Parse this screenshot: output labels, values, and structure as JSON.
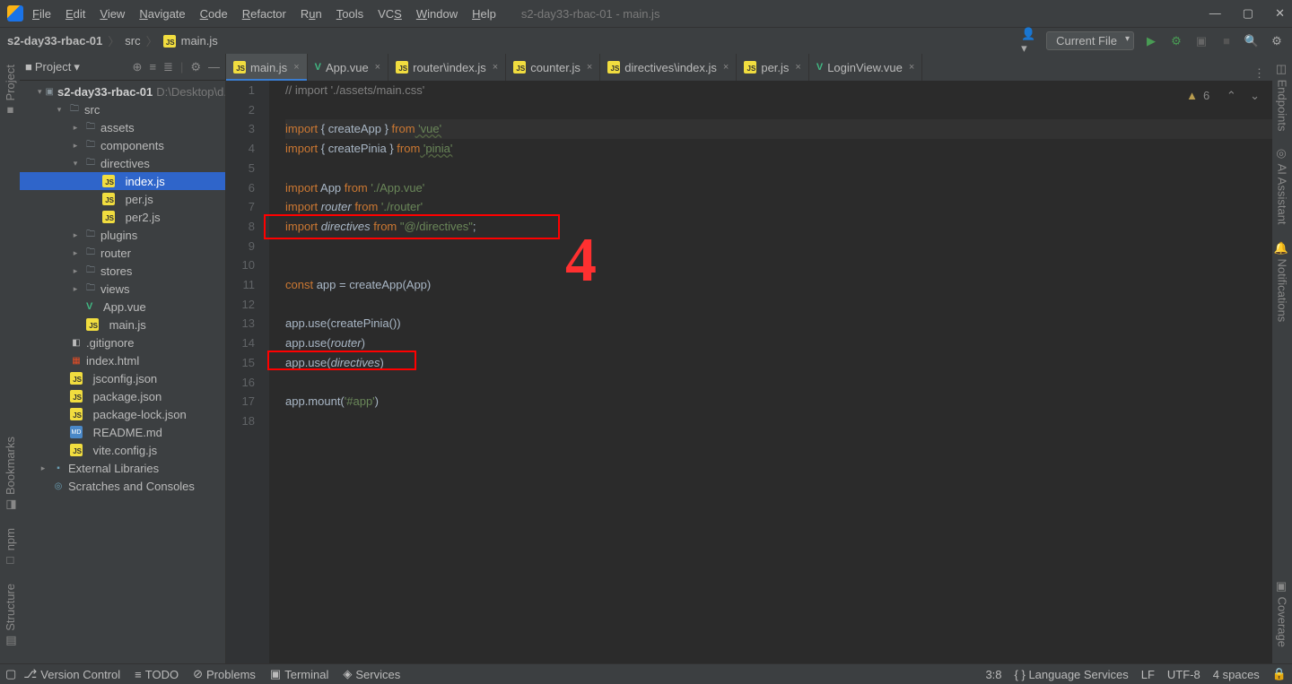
{
  "window": {
    "title": "s2-day33-rbac-01 - main.js",
    "menu": [
      "File",
      "Edit",
      "View",
      "Navigate",
      "Code",
      "Refactor",
      "Run",
      "Tools",
      "VCS",
      "Window",
      "Help"
    ]
  },
  "breadcrumb": {
    "project": "s2-day33-rbac-01",
    "folder": "src",
    "file": "main.js"
  },
  "navbar": {
    "config_dropdown": "Current File"
  },
  "project_panel": {
    "title": "Project",
    "root_name": "s2-day33-rbac-01",
    "root_path": "D:\\Desktop\\d...",
    "src": "src",
    "folders_in_src": {
      "assets": "assets",
      "components": "components",
      "directives": "directives",
      "plugins": "plugins",
      "router": "router",
      "stores": "stores",
      "views": "views"
    },
    "directive_files": {
      "index": "index.js",
      "per": "per.js",
      "per2": "per2.js"
    },
    "app_vue": "App.vue",
    "main_js": "main.js",
    "root_files": {
      "gitignore": ".gitignore",
      "index_html": "index.html",
      "jsconfig": "jsconfig.json",
      "package": "package.json",
      "package_lock": "package-lock.json",
      "readme": "README.md",
      "vite_config": "vite.config.js"
    },
    "external": "External Libraries",
    "scratches": "Scratches and Consoles"
  },
  "tabs": [
    {
      "label": "main.js",
      "type": "js",
      "active": true
    },
    {
      "label": "App.vue",
      "type": "vue",
      "active": false
    },
    {
      "label": "router\\index.js",
      "type": "js",
      "active": false
    },
    {
      "label": "counter.js",
      "type": "js",
      "active": false
    },
    {
      "label": "directives\\index.js",
      "type": "js",
      "active": false
    },
    {
      "label": "per.js",
      "type": "js",
      "active": false
    },
    {
      "label": "LoginView.vue",
      "type": "vue",
      "active": false
    }
  ],
  "editor": {
    "warnings": "6",
    "line_count": 18,
    "lines": {
      "l1": "// import './assets/main.css'",
      "l3_a": "import",
      "l3_b": " { createApp } ",
      "l3_c": "from",
      "l3_d": " 'vue'",
      "l4_a": "import",
      "l4_b": " { createPinia } ",
      "l4_c": "from",
      "l4_d": " 'pinia'",
      "l6_a": "import",
      "l6_b": " App ",
      "l6_c": "from",
      "l6_d": " './App.vue'",
      "l7_a": "import",
      "l7_b": " router ",
      "l7_c": "from",
      "l7_d": " './router'",
      "l8_a": "import",
      "l8_b": " directives ",
      "l8_c": "from",
      "l8_d": " \"@/directives\"",
      "l8_e": ";",
      "l11_a": "const",
      "l11_b": " app = createApp(App)",
      "l13": "app.use(createPinia())",
      "l14_a": "app.use(",
      "l14_b": "router",
      "l14_c": ")",
      "l15_a": "app.use(",
      "l15_b": "directives",
      "l15_c": ")",
      "l17_a": "app.mount(",
      "l17_b": "'#app'",
      "l17_c": ")"
    }
  },
  "annotation": {
    "number": "4"
  },
  "statusbar": {
    "bottom_tabs": {
      "vcs": "Version Control",
      "todo": "TODO",
      "problems": "Problems",
      "terminal": "Terminal",
      "services": "Services"
    },
    "cursor": "3:8",
    "lang": "Language Services",
    "eol": "LF",
    "encoding": "UTF-8",
    "indent": "4 spaces"
  },
  "right_strip": {
    "endpoints": "Endpoints",
    "ai": "AI Assistant",
    "notif": "Notifications",
    "coverage": "Coverage"
  },
  "left_strip": {
    "project": "Project",
    "bookmarks": "Bookmarks",
    "npm": "npm",
    "structure": "Structure"
  }
}
